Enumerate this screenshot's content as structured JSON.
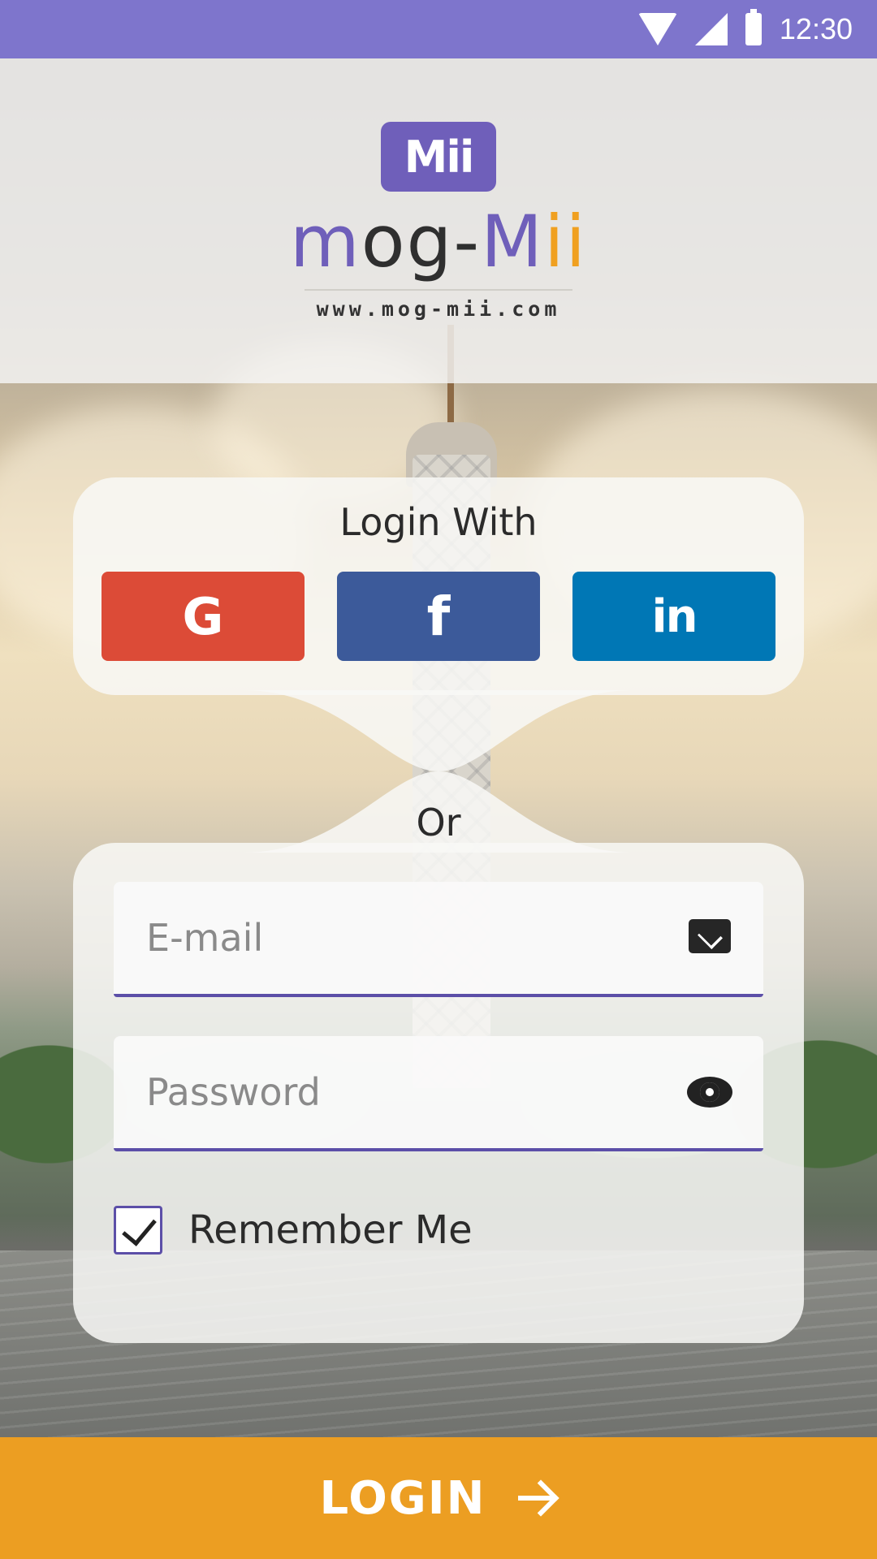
{
  "status_bar": {
    "time": "12:30",
    "icons": [
      "wifi-icon",
      "signal-icon",
      "battery-icon"
    ],
    "background": "#7e75cc"
  },
  "logo": {
    "badge_text": "Mii",
    "word_parts": [
      "m",
      "og-",
      "M",
      "ii"
    ],
    "url": "www.mog-mii.com",
    "colors": {
      "purple": "#6f5fba",
      "dark": "#2f2f2f",
      "orange": "#f0a020"
    }
  },
  "social": {
    "title": "Login With",
    "buttons": [
      {
        "name": "google",
        "glyph": "G",
        "color": "#dc4b37"
      },
      {
        "name": "facebook",
        "glyph": "f",
        "color": "#3c5a9a"
      },
      {
        "name": "linkedin",
        "glyph": "in",
        "color": "#0077b5"
      }
    ]
  },
  "divider_text": "Or",
  "form": {
    "email": {
      "placeholder": "E-mail",
      "value": "",
      "icon": "mail-icon"
    },
    "password": {
      "placeholder": "Password",
      "value": "",
      "icon": "eye-icon"
    },
    "remember": {
      "label": "Remember Me",
      "checked": true
    }
  },
  "login_button": {
    "label": "LOGIN",
    "icon": "arrow-right-icon",
    "color": "#ec9e22"
  }
}
